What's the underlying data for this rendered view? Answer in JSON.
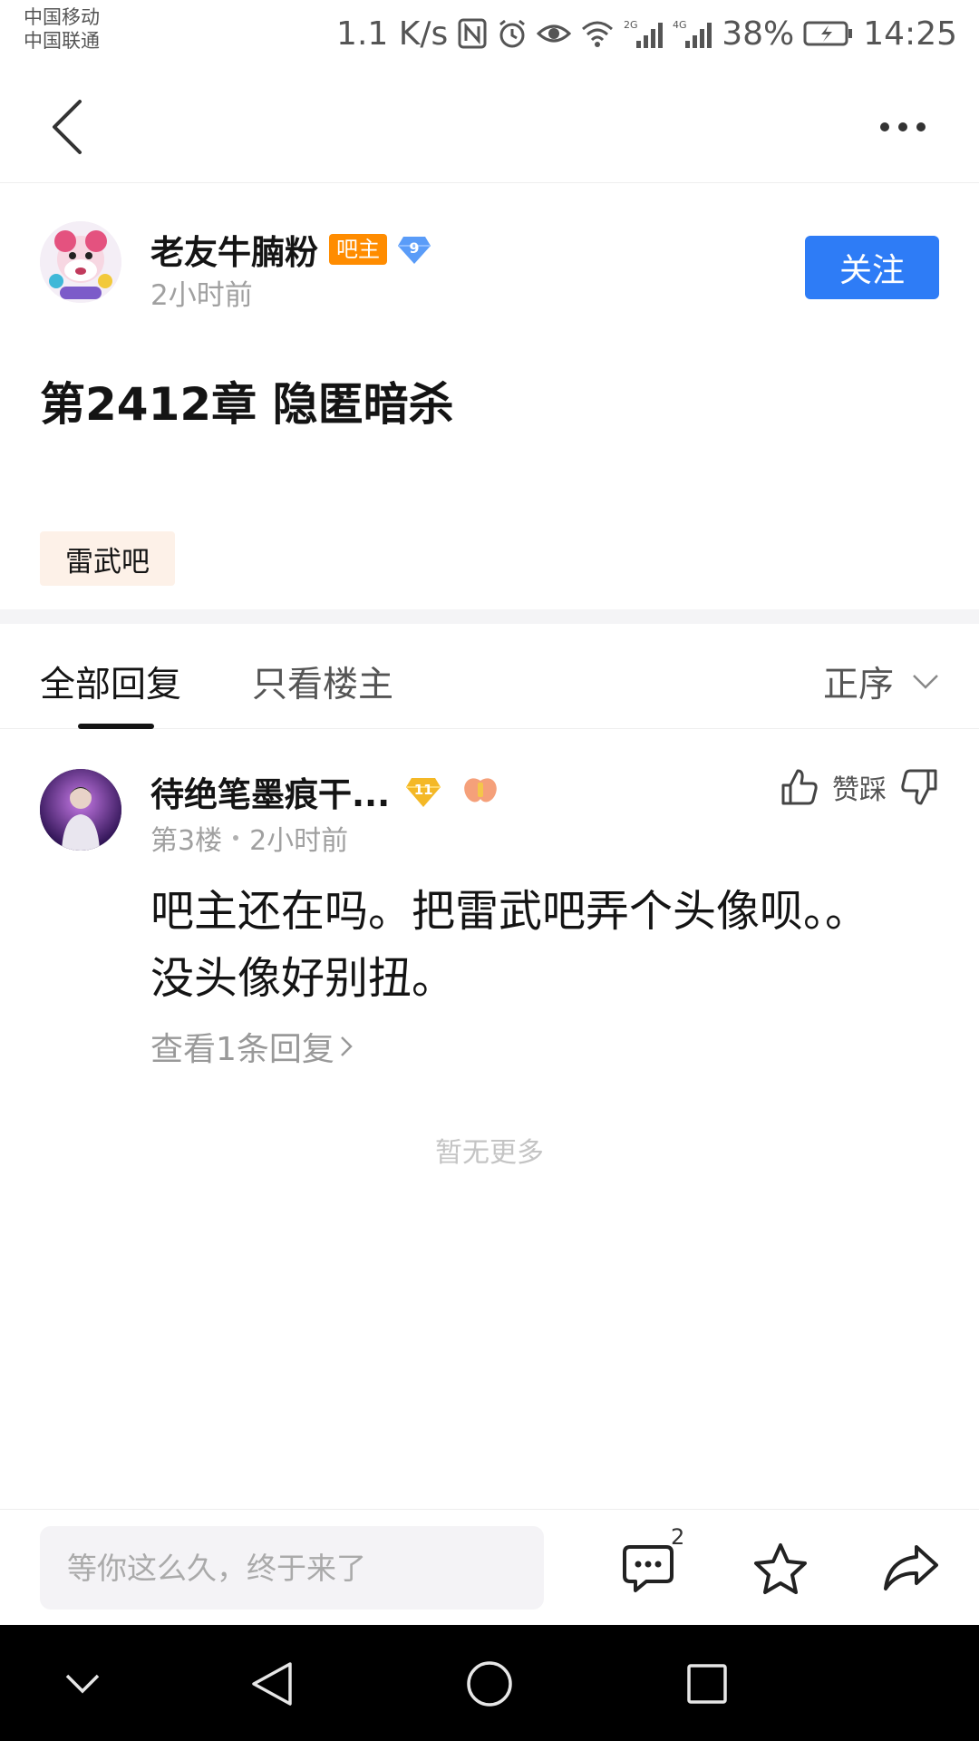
{
  "status_bar": {
    "carrier_1": "中国移动",
    "carrier_2": "中国联通",
    "net_speed": "1.1 K/s",
    "signal_2g": "2G",
    "signal_4g": "4G",
    "battery": "38%",
    "time": "14:25"
  },
  "nav": {
    "back_icon": "chevron-left-icon",
    "more_icon": "more-dots-icon"
  },
  "author": {
    "name": "老友牛腩粉",
    "role_badge": "吧主",
    "level": "9",
    "time": "2小时前",
    "follow_label": "关注"
  },
  "post": {
    "title": "第2412章 隐匿暗杀",
    "forum_tag": "雷武吧"
  },
  "tabs": {
    "all_replies": "全部回复",
    "op_only": "只看楼主",
    "sort": "正序"
  },
  "reply": {
    "user_name": "待绝笔墨痕干...",
    "level": "11",
    "floor": "第3楼",
    "time": "2小时前",
    "vote_label": "赞踩",
    "content": "吧主还在吗。把雷武吧弄个头像呗。。没头像好别扭。",
    "view_replies": "查看1条回复"
  },
  "no_more": "暂无更多",
  "bottom_bar": {
    "input_placeholder": "等你这么久，终于来了",
    "comment_count": "2"
  },
  "colors": {
    "accent_blue": "#2e7cf6",
    "owner_badge": "#ff8c00",
    "forum_tag_bg": "#fdf1e8"
  }
}
